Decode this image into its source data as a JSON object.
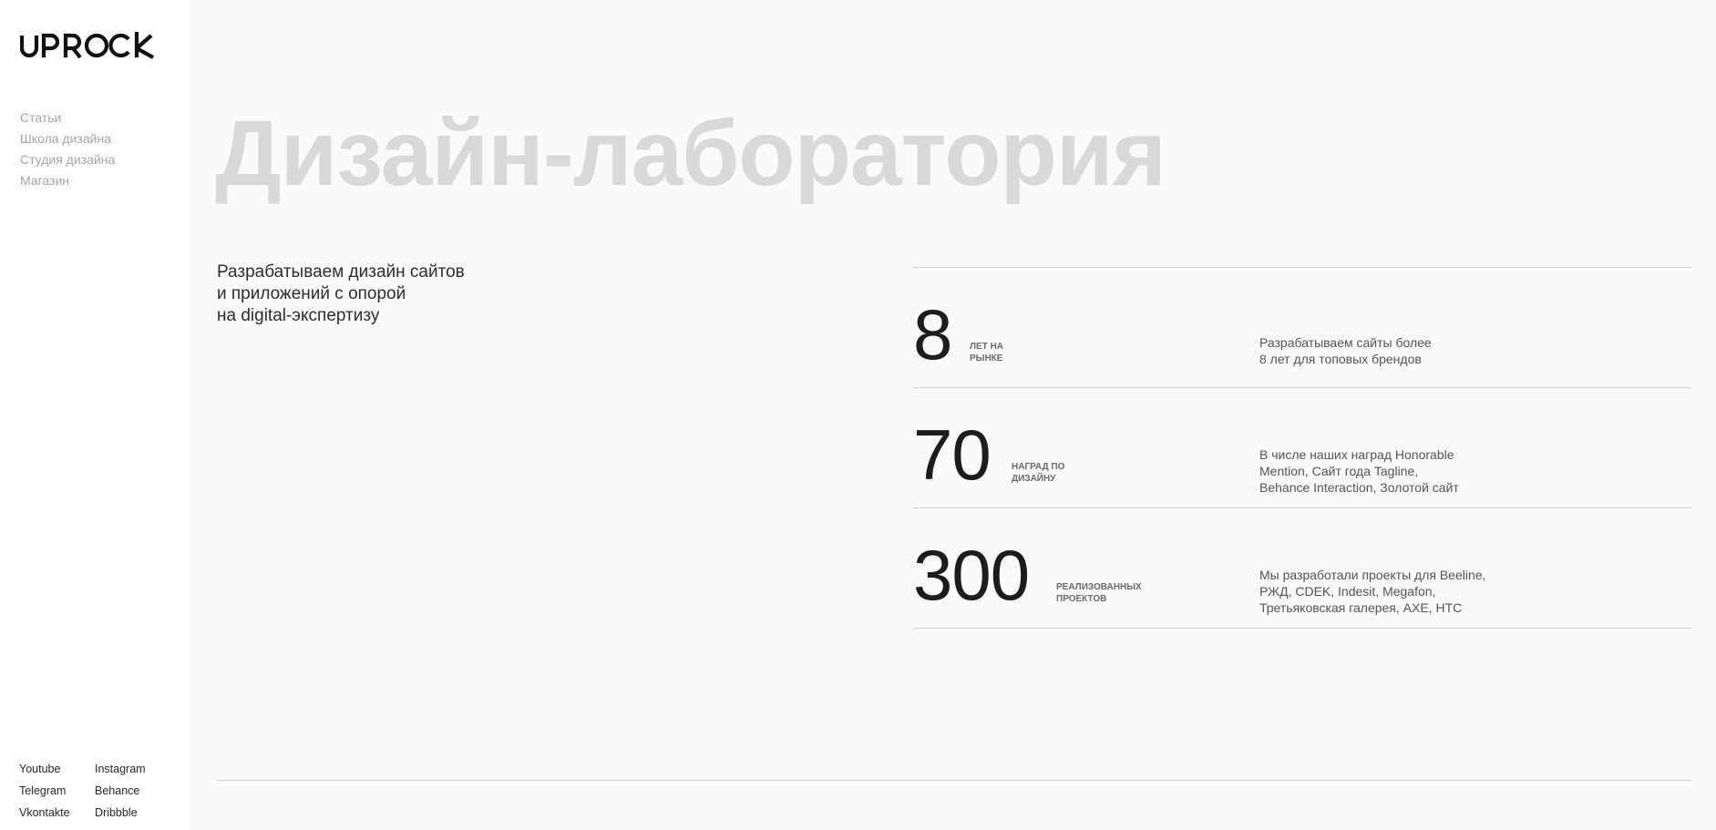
{
  "brand": {
    "logo_text": "UPROCK"
  },
  "sidebar": {
    "nav": [
      {
        "label": "Статьи"
      },
      {
        "label": "Школа дизайна"
      },
      {
        "label": "Студия дизайна"
      },
      {
        "label": "Магазин"
      }
    ],
    "socials": [
      {
        "label": "Youtube"
      },
      {
        "label": "Instagram"
      },
      {
        "label": "Telegram"
      },
      {
        "label": "Behance"
      },
      {
        "label": "Vkontakte"
      },
      {
        "label": "Dribbble"
      }
    ]
  },
  "hero": {
    "title": "Дизайн-лаборатория",
    "intro": [
      "Разрабатываем дизайн сайтов",
      "и приложений с опорой",
      "на digital-экспертизу"
    ]
  },
  "stats": [
    {
      "number": "8",
      "label": [
        "ЛЕТ НА",
        "РЫНКЕ"
      ],
      "description": [
        "Разрабатываем сайты более",
        "8 лет для топовых брендов"
      ]
    },
    {
      "number": "70",
      "label": [
        "НАГРАД ПО",
        "ДИЗАЙНУ"
      ],
      "description": [
        "В числе наших наград Honorable",
        "Mention, Сайт года Tagline,",
        "Behance Interaction, Золотой сайт"
      ]
    },
    {
      "number": "300",
      "label": [
        "РЕАЛИЗОВАННЫХ",
        "ПРОЕКТОВ"
      ],
      "description": [
        "Мы разработали проекты для Beeline,",
        "РЖД, CDEK, Indesit, Megafon,",
        "Третьяковская галерея, AXE, HTC"
      ]
    }
  ],
  "colors": {
    "sidebar_bg": "#ffffff",
    "page_bg": "#fafafa",
    "hero_title": "#d9d9d9",
    "nav_text": "#a6a6a6",
    "divider": "#cfcfcf"
  }
}
